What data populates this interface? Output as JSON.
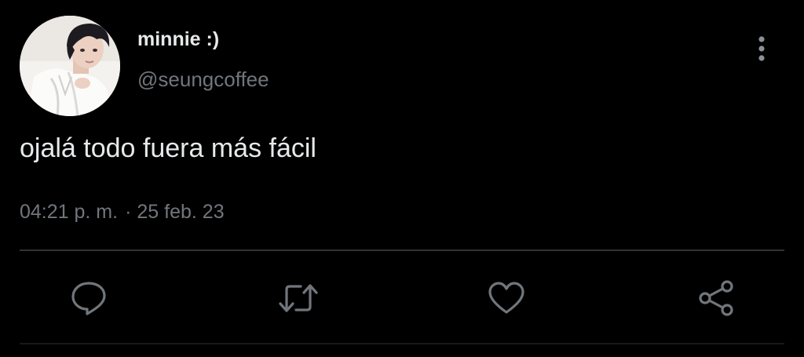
{
  "tweet": {
    "author": {
      "display_name": "minnie :)",
      "handle": "@seungcoffee"
    },
    "text": "ojalá todo fuera más fácil",
    "time": "04:21 p. m.",
    "separator": "·",
    "date": "25 feb. 23"
  },
  "icons": {
    "more": "more-vertical-icon",
    "reply": "reply-icon",
    "retweet": "retweet-icon",
    "like": "heart-icon",
    "share": "share-icon"
  },
  "colors": {
    "background": "#000000",
    "primary_text": "#e7e9ea",
    "secondary_text": "#71767b",
    "divider": "#2f3336",
    "icon": "#71767b"
  }
}
